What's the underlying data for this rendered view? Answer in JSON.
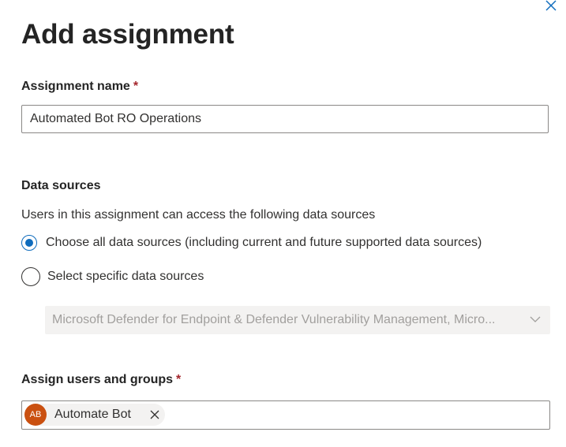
{
  "panel": {
    "title": "Add assignment",
    "close_icon": "close-icon"
  },
  "assignment_name": {
    "label": "Assignment name",
    "required_marker": "*",
    "value": "Automated Bot RO Operations"
  },
  "data_sources": {
    "label": "Data sources",
    "description": "Users in this assignment can access the following data sources",
    "options": [
      {
        "label": "Choose all data sources (including current and future supported data sources)",
        "selected": true
      },
      {
        "label": "Select specific data sources",
        "selected": false
      }
    ],
    "dropdown": {
      "value": "Microsoft Defender for Endpoint & Defender Vulnerability Management, Micro...",
      "disabled": true,
      "icon": "chevron-down-icon"
    }
  },
  "assign_users": {
    "label": "Assign users and groups",
    "required_marker": "*",
    "selected": [
      {
        "initials": "AB",
        "name": "Automate Bot",
        "avatar_color": "#ca5010"
      }
    ]
  },
  "colors": {
    "accent": "#0f6cbd",
    "required": "#a4262c"
  }
}
